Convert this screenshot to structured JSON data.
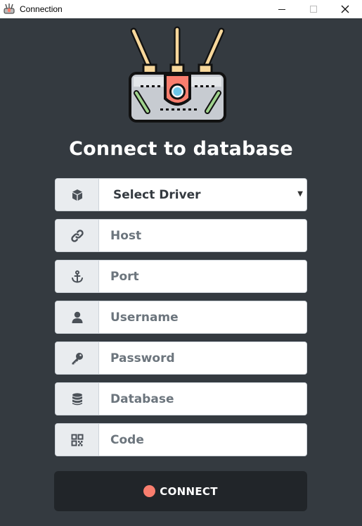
{
  "window": {
    "title": "Connection",
    "icons": {
      "app": "router-icon",
      "minimize": "minimize-icon",
      "maximize": "maximize-icon",
      "close": "close-icon"
    }
  },
  "colors": {
    "background": "#343a40",
    "prefix_bg": "#e9ecef",
    "button_bg": "#212529",
    "accent": "#f97e6e"
  },
  "heading": "Connect to database",
  "form": {
    "driver": {
      "icon": "cube-icon",
      "selected": "Select Driver"
    },
    "host": {
      "icon": "link-icon",
      "placeholder": "Host"
    },
    "port": {
      "icon": "anchor-icon",
      "placeholder": "Port"
    },
    "username": {
      "icon": "user-icon",
      "placeholder": "Username"
    },
    "password": {
      "icon": "key-icon",
      "placeholder": "Password"
    },
    "database": {
      "icon": "database-icon",
      "placeholder": "Database"
    },
    "code": {
      "icon": "qrcode-icon",
      "placeholder": "Code"
    }
  },
  "connect_button": {
    "label": "CONNECT"
  }
}
